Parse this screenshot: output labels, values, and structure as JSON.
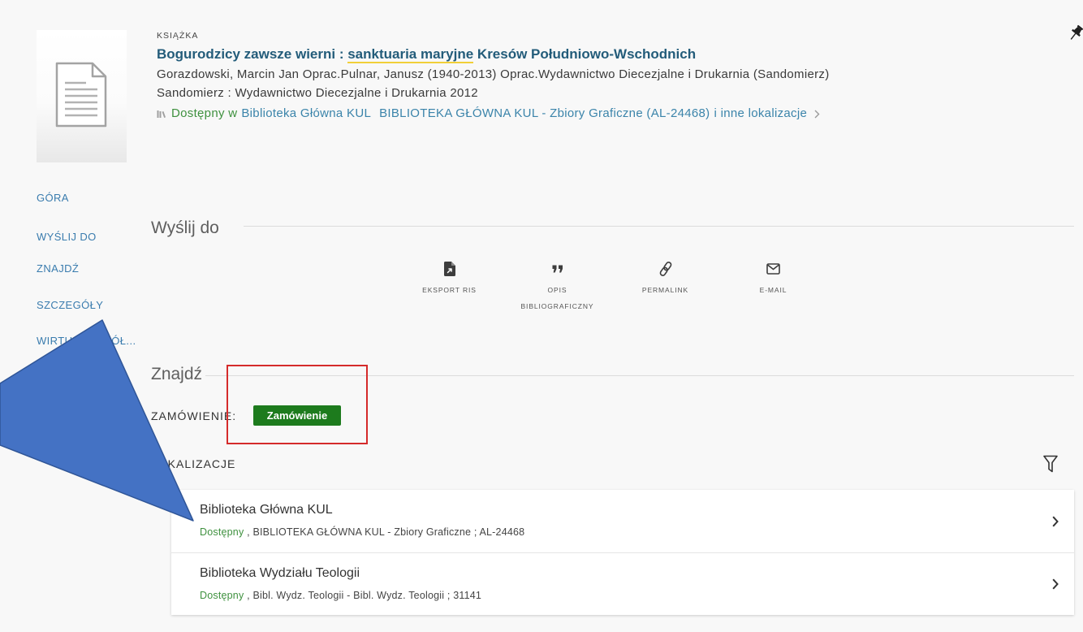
{
  "colors": {
    "title": "#235c7a",
    "link": "#3b84aa",
    "nav": "#3a7cae",
    "available": "#3f913f",
    "order-bg": "#1d7b1d",
    "highlight": "#f1cf38",
    "annot-red": "#d52b2b",
    "annot-blue": "#4472c4",
    "annot-blue-edge": "#2f5597"
  },
  "record": {
    "thumbnail_icon": "document-icon",
    "pin_icon": "pin-icon",
    "type_label": "KSIĄŻKA",
    "title": {
      "before": "Bogurodzicy zawsze wierni : ",
      "highlight": "sanktuaria maryjne",
      "after": " Kresów Południowo-Wschodnich"
    },
    "authors": "Gorazdowski, Marcin Jan Oprac.Pulnar, Janusz (1940-2013) Oprac.Wydawnictwo Diecezjalne i Drukarnia (Sandomierz)",
    "publication": "Sandomierz : Wydawnictwo Diecezjalne i Drukarnia 2012",
    "availability": {
      "icon": "library-shelf-icon",
      "status": "Dostępny w",
      "library": "Biblioteka Główna KUL",
      "sublocation": "BIBLIOTEKA GŁÓWNA KUL - Zbiory Graficzne (AL-24468)",
      "more": "i inne lokalizacje",
      "chevron_icon": "chevron-right-icon"
    }
  },
  "nav": {
    "items": [
      "GÓRA",
      "WYŚLIJ DO",
      "ZNAJDŹ",
      "SZCZEGÓŁY",
      "WIRTUALNA PÓŁ...",
      "LINKI"
    ]
  },
  "send_to": {
    "heading": "Wyślij do",
    "actions": [
      {
        "label": "EKSPORT RIS",
        "icon": "export-ris-icon"
      },
      {
        "label": "OPIS BIBLIOGRAFICZNY",
        "icon": "quote-icon"
      },
      {
        "label": "PERMALINK",
        "icon": "link-icon"
      },
      {
        "label": "E-MAIL",
        "icon": "envelope-icon"
      }
    ]
  },
  "find": {
    "heading": "Znajdź",
    "order_label": "ZAMÓWIENIE:",
    "order_button": "Zamówienie"
  },
  "locations": {
    "heading": "LOKALIZACJE",
    "filter_icon": "filter-icon",
    "items": [
      {
        "name": "Biblioteka Główna KUL",
        "status": "Dostępny",
        "details": " , BIBLIOTEKA GŁÓWNA KUL - Zbiory Graficzne ; AL-24468"
      },
      {
        "name": "Biblioteka Wydziału Teologii",
        "status": "Dostępny",
        "details": " , Bibl. Wydz. Teologii - Bibl. Wydz. Teologii ; 31141"
      }
    ]
  }
}
